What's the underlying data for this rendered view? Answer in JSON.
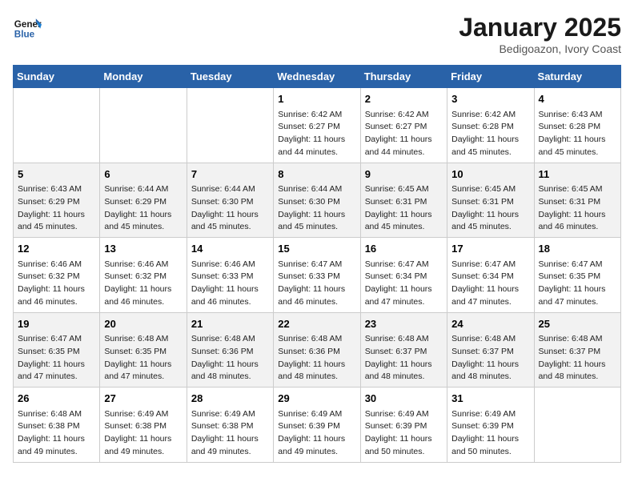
{
  "header": {
    "logo_line1": "General",
    "logo_line2": "Blue",
    "title": "January 2025",
    "subtitle": "Bedigoazon, Ivory Coast"
  },
  "days_of_week": [
    "Sunday",
    "Monday",
    "Tuesday",
    "Wednesday",
    "Thursday",
    "Friday",
    "Saturday"
  ],
  "weeks": [
    [
      {
        "day": "",
        "info": ""
      },
      {
        "day": "",
        "info": ""
      },
      {
        "day": "",
        "info": ""
      },
      {
        "day": "1",
        "info": "Sunrise: 6:42 AM\nSunset: 6:27 PM\nDaylight: 11 hours and 44 minutes."
      },
      {
        "day": "2",
        "info": "Sunrise: 6:42 AM\nSunset: 6:27 PM\nDaylight: 11 hours and 44 minutes."
      },
      {
        "day": "3",
        "info": "Sunrise: 6:42 AM\nSunset: 6:28 PM\nDaylight: 11 hours and 45 minutes."
      },
      {
        "day": "4",
        "info": "Sunrise: 6:43 AM\nSunset: 6:28 PM\nDaylight: 11 hours and 45 minutes."
      }
    ],
    [
      {
        "day": "5",
        "info": "Sunrise: 6:43 AM\nSunset: 6:29 PM\nDaylight: 11 hours and 45 minutes."
      },
      {
        "day": "6",
        "info": "Sunrise: 6:44 AM\nSunset: 6:29 PM\nDaylight: 11 hours and 45 minutes."
      },
      {
        "day": "7",
        "info": "Sunrise: 6:44 AM\nSunset: 6:30 PM\nDaylight: 11 hours and 45 minutes."
      },
      {
        "day": "8",
        "info": "Sunrise: 6:44 AM\nSunset: 6:30 PM\nDaylight: 11 hours and 45 minutes."
      },
      {
        "day": "9",
        "info": "Sunrise: 6:45 AM\nSunset: 6:31 PM\nDaylight: 11 hours and 45 minutes."
      },
      {
        "day": "10",
        "info": "Sunrise: 6:45 AM\nSunset: 6:31 PM\nDaylight: 11 hours and 45 minutes."
      },
      {
        "day": "11",
        "info": "Sunrise: 6:45 AM\nSunset: 6:31 PM\nDaylight: 11 hours and 46 minutes."
      }
    ],
    [
      {
        "day": "12",
        "info": "Sunrise: 6:46 AM\nSunset: 6:32 PM\nDaylight: 11 hours and 46 minutes."
      },
      {
        "day": "13",
        "info": "Sunrise: 6:46 AM\nSunset: 6:32 PM\nDaylight: 11 hours and 46 minutes."
      },
      {
        "day": "14",
        "info": "Sunrise: 6:46 AM\nSunset: 6:33 PM\nDaylight: 11 hours and 46 minutes."
      },
      {
        "day": "15",
        "info": "Sunrise: 6:47 AM\nSunset: 6:33 PM\nDaylight: 11 hours and 46 minutes."
      },
      {
        "day": "16",
        "info": "Sunrise: 6:47 AM\nSunset: 6:34 PM\nDaylight: 11 hours and 47 minutes."
      },
      {
        "day": "17",
        "info": "Sunrise: 6:47 AM\nSunset: 6:34 PM\nDaylight: 11 hours and 47 minutes."
      },
      {
        "day": "18",
        "info": "Sunrise: 6:47 AM\nSunset: 6:35 PM\nDaylight: 11 hours and 47 minutes."
      }
    ],
    [
      {
        "day": "19",
        "info": "Sunrise: 6:47 AM\nSunset: 6:35 PM\nDaylight: 11 hours and 47 minutes."
      },
      {
        "day": "20",
        "info": "Sunrise: 6:48 AM\nSunset: 6:35 PM\nDaylight: 11 hours and 47 minutes."
      },
      {
        "day": "21",
        "info": "Sunrise: 6:48 AM\nSunset: 6:36 PM\nDaylight: 11 hours and 48 minutes."
      },
      {
        "day": "22",
        "info": "Sunrise: 6:48 AM\nSunset: 6:36 PM\nDaylight: 11 hours and 48 minutes."
      },
      {
        "day": "23",
        "info": "Sunrise: 6:48 AM\nSunset: 6:37 PM\nDaylight: 11 hours and 48 minutes."
      },
      {
        "day": "24",
        "info": "Sunrise: 6:48 AM\nSunset: 6:37 PM\nDaylight: 11 hours and 48 minutes."
      },
      {
        "day": "25",
        "info": "Sunrise: 6:48 AM\nSunset: 6:37 PM\nDaylight: 11 hours and 48 minutes."
      }
    ],
    [
      {
        "day": "26",
        "info": "Sunrise: 6:48 AM\nSunset: 6:38 PM\nDaylight: 11 hours and 49 minutes."
      },
      {
        "day": "27",
        "info": "Sunrise: 6:49 AM\nSunset: 6:38 PM\nDaylight: 11 hours and 49 minutes."
      },
      {
        "day": "28",
        "info": "Sunrise: 6:49 AM\nSunset: 6:38 PM\nDaylight: 11 hours and 49 minutes."
      },
      {
        "day": "29",
        "info": "Sunrise: 6:49 AM\nSunset: 6:39 PM\nDaylight: 11 hours and 49 minutes."
      },
      {
        "day": "30",
        "info": "Sunrise: 6:49 AM\nSunset: 6:39 PM\nDaylight: 11 hours and 50 minutes."
      },
      {
        "day": "31",
        "info": "Sunrise: 6:49 AM\nSunset: 6:39 PM\nDaylight: 11 hours and 50 minutes."
      },
      {
        "day": "",
        "info": ""
      }
    ]
  ]
}
